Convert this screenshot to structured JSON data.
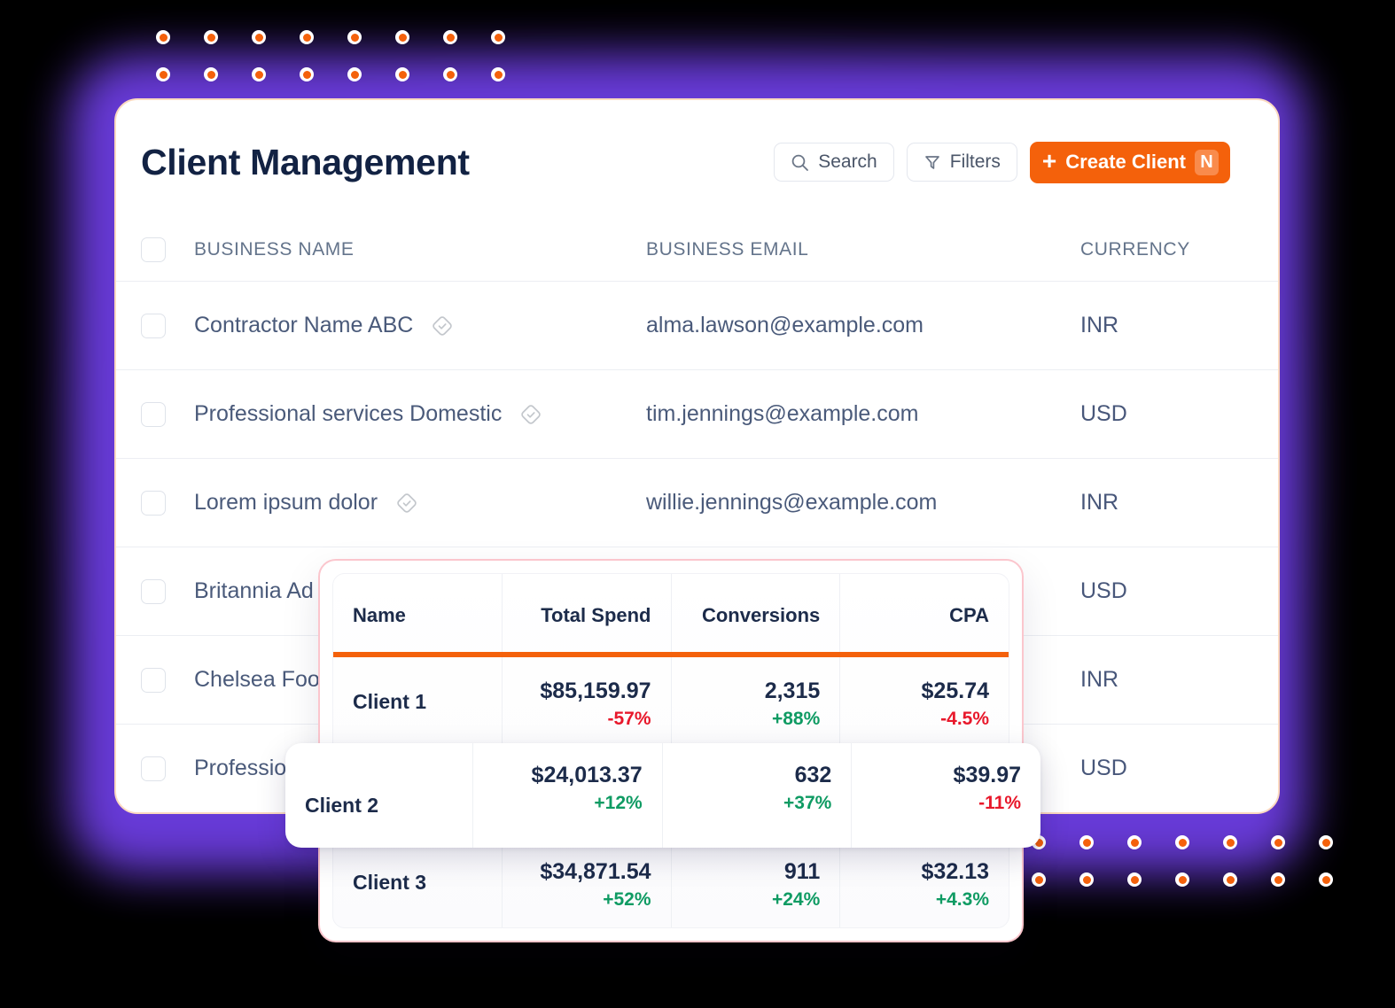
{
  "header": {
    "title": "Client Management",
    "search_label": "Search",
    "search_icon": "search-icon",
    "filters_label": "Filters",
    "filters_icon": "filter-funnel-icon",
    "create_label": "Create Client",
    "create_plus_icon": "plus-icon",
    "create_shortcut_badge": "N",
    "accent_color": "#f4610b"
  },
  "client_table": {
    "columns": [
      "BUSINESS NAME",
      "BUSINESS EMAIL",
      "CURRENCY"
    ],
    "select_all_checkbox": false,
    "rows": [
      {
        "name": "Contractor Name ABC",
        "verified_icon": "verified-diamond-check-icon",
        "email": "alma.lawson@example.com",
        "currency": "INR",
        "checked": false
      },
      {
        "name": "Professional services Domestic",
        "verified_icon": "verified-diamond-check-icon",
        "email": "tim.jennings@example.com",
        "currency": "USD",
        "checked": false
      },
      {
        "name": "Lorem ipsum dolor",
        "verified_icon": "verified-diamond-check-icon",
        "email": "willie.jennings@example.com",
        "currency": "INR",
        "checked": false
      },
      {
        "name": "Britannia Ad",
        "verified_icon": "",
        "email": "",
        "currency": "USD",
        "checked": false
      },
      {
        "name": "Chelsea Foo",
        "verified_icon": "",
        "email": "",
        "currency": "INR",
        "checked": false
      },
      {
        "name": "Professio",
        "verified_icon": "",
        "email": "",
        "currency": "USD",
        "checked": false
      }
    ]
  },
  "metrics_overlay": {
    "border_color": "#fbc6cd",
    "accent_underline_color": "#f4610b",
    "columns": [
      "Name",
      "Total Spend",
      "Conversions",
      "CPA"
    ],
    "rows": [
      {
        "name": "Client 1",
        "total_spend": "$85,159.97",
        "total_spend_delta": "-57%",
        "total_spend_dir": "down",
        "conversions": "2,315",
        "conversions_delta": "+88%",
        "conversions_dir": "up",
        "cpa": "$25.74",
        "cpa_delta": "-4.5%",
        "cpa_dir": "down"
      },
      {
        "name": "Client 3",
        "total_spend": "$34,871.54",
        "total_spend_delta": "+52%",
        "total_spend_dir": "up",
        "conversions": "911",
        "conversions_delta": "+24%",
        "conversions_dir": "up",
        "cpa": "$32.13",
        "cpa_delta": "+4.3%",
        "cpa_dir": "up"
      }
    ],
    "floating_row": {
      "name": "Client 2",
      "total_spend": "$24,013.37",
      "total_spend_delta": "+12%",
      "total_spend_dir": "up",
      "conversions": "632",
      "conversions_delta": "+37%",
      "conversions_dir": "up",
      "cpa": "$39.97",
      "cpa_delta": "-11%",
      "cpa_dir": "down"
    }
  },
  "decoration": {
    "dot_color": "#f4610b",
    "dot_ring_color": "#ffffff",
    "glow_color": "#6c3de0",
    "top_dot_rows": 2,
    "top_dot_cols": 8,
    "bottom_dot_rows": 2,
    "bottom_dot_cols": 7
  },
  "colors": {
    "positive": "#0f9b63",
    "negative": "#e8182b",
    "title": "#122243",
    "card_border": "#fbd9c0"
  }
}
